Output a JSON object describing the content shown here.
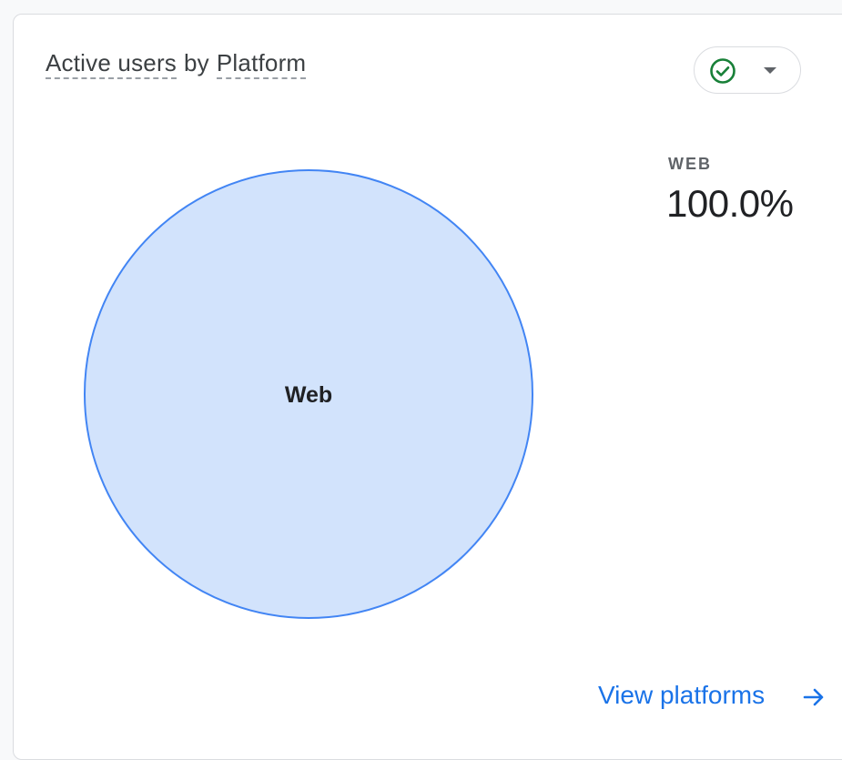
{
  "card": {
    "title_metric": "Active users",
    "title_by": "by",
    "title_dimension": "Platform",
    "status_icon": "check-circle-icon",
    "status_color": "#188038"
  },
  "legend": {
    "label": "WEB",
    "value": "100.0%"
  },
  "footer": {
    "link_label": "View platforms",
    "link_icon": "arrow-right-icon",
    "link_color": "#1a73e8"
  },
  "chart_data": {
    "type": "pie",
    "title": "Active users by Platform",
    "categories": [
      "Web"
    ],
    "values": [
      100.0
    ],
    "colors": {
      "fill": "#d2e3fc",
      "stroke": "#4285f4"
    }
  }
}
